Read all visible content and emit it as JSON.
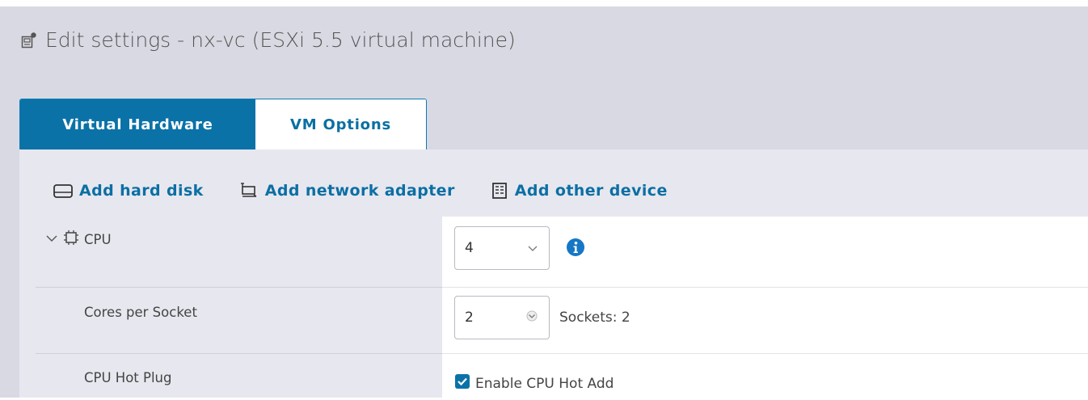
{
  "dialog": {
    "title": "Edit settings - nx-vc (ESXi 5.5 virtual machine)"
  },
  "tabs": [
    {
      "label": "Virtual Hardware",
      "active": true
    },
    {
      "label": "VM Options",
      "active": false
    }
  ],
  "toolbar": {
    "add_hard_disk": "Add hard disk",
    "add_network_adapter": "Add network adapter",
    "add_other_device": "Add other device"
  },
  "cpu": {
    "label": "CPU",
    "value": "4",
    "cores_per_socket_label": "Cores per Socket",
    "cores_per_socket_value": "2",
    "sockets_text": "Sockets: 2",
    "hot_plug_label": "CPU Hot Plug",
    "hot_add_label": "Enable CPU Hot Add",
    "hot_add_checked": true
  },
  "colors": {
    "accent": "#0b72a8",
    "panel_bg": "#e7e7ef",
    "dialog_bg": "#d9d9e3",
    "info_blue": "#1677c5"
  }
}
